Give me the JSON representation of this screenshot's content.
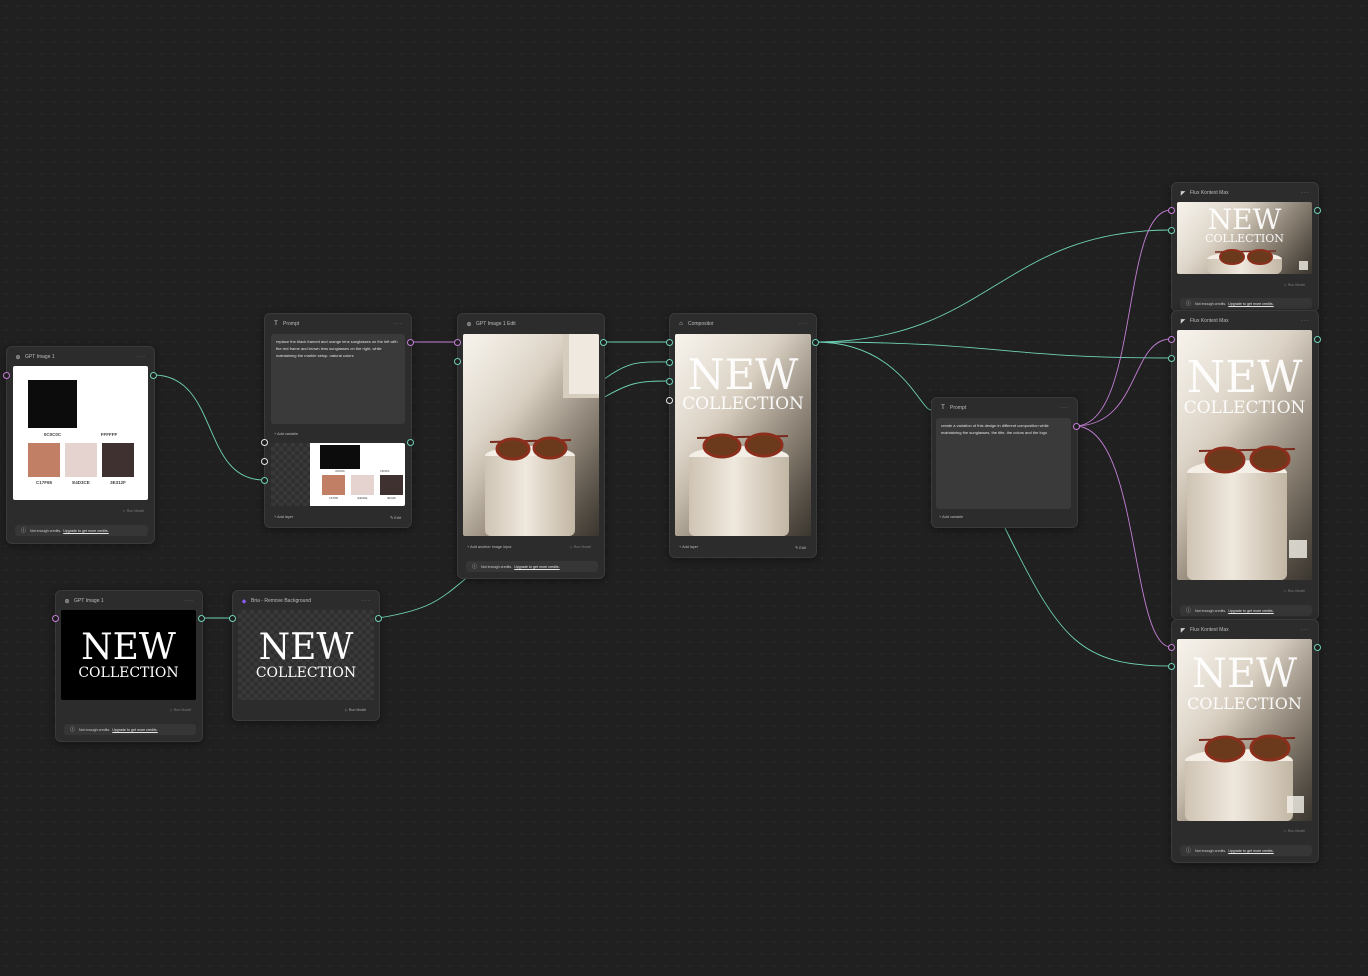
{
  "nodes": {
    "gpt1_palette": {
      "title": "GPT Image 1",
      "menu": "···",
      "swatches": [
        {
          "hex": "#0C0C0C",
          "label": "0C0C0C"
        },
        {
          "hex": "#FFFFFF",
          "label": "FFFFFF"
        },
        {
          "hex": "#C17F65",
          "label": "C17F65"
        },
        {
          "hex": "#E4D3CE",
          "label": "E4D3CE"
        },
        {
          "hex": "#3E312F",
          "label": "3E312F"
        }
      ],
      "run": "Run Model",
      "credit": {
        "text": "Not enough credits.",
        "link": "Upgrade to get more credits."
      }
    },
    "prompt1": {
      "title": "Prompt",
      "menu": "···",
      "text": "replace the black framed and orange lens sunglasses on the left with the red frame and brown lens sunglasses on the right, while maintaining the marble setup. natural colors",
      "add_variable": "+ Add variable",
      "add_layer": "+ Add layer",
      "edit": "Edit",
      "mini_labels": [
        "0C0C0C",
        "FFFFFF",
        "C17F65",
        "E4D3CE",
        "3E312F"
      ]
    },
    "gpt_edit": {
      "title": "GPT Image 1 Edit",
      "add_input": "+ Add another image input",
      "run": "Run Model",
      "credit": {
        "text": "Not enough credits.",
        "link": "Upgrade to get more credits."
      }
    },
    "compositor": {
      "title": "Compositor",
      "menu": "···",
      "add_layer": "+ Add layer",
      "edit": "Edit",
      "new": "NEW",
      "collection": "COLLECTION"
    },
    "prompt2": {
      "title": "Prompt",
      "menu": "···",
      "text": "create a variation of this design in different composition while maintaining the sunglasses, the title, the colors and the logo",
      "add_variable": "+ Add variable"
    },
    "gpt1_text": {
      "title": "GPT Image 1",
      "menu": "···",
      "new": "NEW",
      "collection": "COLLECTION",
      "run": "Run Model",
      "credit": {
        "text": "Not enough credits.",
        "link": "Upgrade to get more credits."
      }
    },
    "bria": {
      "title": "Bria - Remove Background",
      "menu": "···",
      "new": "NEW",
      "collection": "COLLECTION",
      "run": "Run Model"
    },
    "flux": [
      {
        "title": "Flux Kontext Max",
        "menu": "···",
        "new": "NEW",
        "collection": "COLLECTION",
        "run": "Run Model",
        "credit": {
          "text": "Not enough credits.",
          "link": "Upgrade to get more credits."
        }
      },
      {
        "title": "Flux Kontext Max",
        "menu": "···",
        "new": "NEW",
        "collection": "COLLECTION",
        "run": "Run Model",
        "credit": {
          "text": "Not enough credits.",
          "link": "Upgrade to get more credits."
        }
      },
      {
        "title": "Flux Kontext Max",
        "menu": "···",
        "new": "NEW",
        "collection": "COLLECTION",
        "run": "Run Model",
        "credit": {
          "text": "Not enough credits.",
          "link": "Upgrade to get more credits."
        }
      }
    ]
  },
  "colors": {
    "canvas": "#202020",
    "node": "#2c2c2c",
    "edge_image": "#6fd3b7",
    "edge_text": "#c47fd6"
  }
}
